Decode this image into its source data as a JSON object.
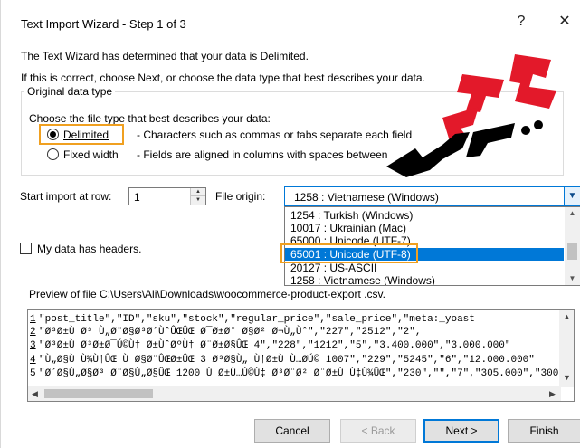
{
  "window": {
    "title": "Text Import Wizard - Step 1 of 3",
    "help_label": "?",
    "close_label": "✕"
  },
  "intro": {
    "line1": "The Text Wizard has determined that your data is Delimited.",
    "line2": "If this is correct, choose Next, or choose the data type that best describes your data."
  },
  "original_data_type": {
    "group_label": "Original data type",
    "prompt": "Choose the file type that best describes your data:",
    "options": [
      {
        "label": "Delimited",
        "description": "- Characters such as commas or tabs separate each field",
        "selected": true
      },
      {
        "label": "Fixed width",
        "description": "- Fields are aligned in columns with spaces between",
        "selected": false
      }
    ]
  },
  "start_import": {
    "label": "Start import at row:",
    "value": "1"
  },
  "file_origin": {
    "label": "File origin:",
    "value": "1258 : Vietnamese (Windows)",
    "options": [
      "1254 : Turkish (Windows)",
      "10017 : Ukrainian (Mac)",
      "65000 : Unicode (UTF-7)",
      "65001 : Unicode (UTF-8)",
      "20127 : US-ASCII",
      "1258 : Vietnamese (Windows)"
    ],
    "highlighted_option": "65001 : Unicode (UTF-8)"
  },
  "headers_checkbox": {
    "label": "My data has headers.",
    "checked": false
  },
  "preview": {
    "label": "Preview of file C:\\Users\\Ali\\Downloads\\woocommerce-product-export .csv.",
    "lines": [
      {
        "num": "1",
        "text": "\"post_title\",\"ID\",\"sku\",\"stock\",\"regular_price\",\"sale_price\",\"meta:_yoast"
      },
      {
        "num": "2",
        "text": "\"Ø³Ø±Ù Ø³ Ù„Ø¨Ø§Ø³Ø´ÙˆÛŒÛŒ Ø¯Ø±Ø¨ Ø§Ø² Ø¬Ù„Ùˆ\",\"227\",\"2512\",\"2\","
      },
      {
        "num": "3",
        "text": "\"Ø³Ø±Ù Ø³Ø±Ø¯Ú©Ù† Ø±ÙˆØºÙ† Ø¨Ø±Ø§ÛŒ 4\",\"228\",\"1212\",\"5\",\"3.400.000\",\"3.000.000\""
      },
      {
        "num": "4",
        "text": "\"Ù„Ø§Ù Ù¾Ù†ÛŒ Ù Ø§Ø¨ÛŒØ±ÛŒ 3 Ø³Ø§Ù„ Ù†Ø±Ù Ù…Ø­Ú© 1007\",\"229\",\"5245\",\"6\",\"12.000.000\""
      },
      {
        "num": "5",
        "text": "\"Ø´Ø§Ù„Ø§Ø³ Ø¨Ø§Ù„Ø§ÛŒ 1200 Ù Ø±Ù…Ú©Ù‡ Ø³Ø¨Ø² Ø¨Ø±Ù Ù‡Ù¾ÛŒ\",\"230\",\"\",\"7\",\"305.000\",\"300"
      }
    ]
  },
  "buttons": {
    "cancel": "Cancel",
    "back": "< Back",
    "next": "Next >",
    "finish": "Finish"
  },
  "icons": {
    "scroll_up": "▲",
    "scroll_down": "▼",
    "scroll_left": "◀",
    "scroll_right": "▶",
    "dropdown": "▼",
    "spin_up": "▲",
    "spin_down": "▼"
  },
  "colors": {
    "accent": "#0078d7",
    "highlight_outline": "#f0a020",
    "watermark": "#e3192a"
  }
}
